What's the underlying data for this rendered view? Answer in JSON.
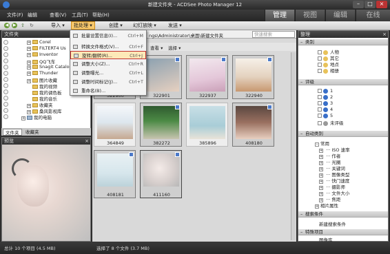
{
  "window": {
    "title": "新建文件夹 - ACDSee Photo Manager 12"
  },
  "menu": {
    "items": [
      "文件(F)",
      "编辑",
      "查看(V)",
      "工具(T)",
      "帮助(H)"
    ]
  },
  "modes": [
    "管理",
    "视图",
    "编辑",
    "在线"
  ],
  "toolbar": {
    "import": "导入",
    "batch": "批处理",
    "create": "创建",
    "slideshow": "幻灯放映",
    "send": "发送"
  },
  "batch_menu": {
    "items": [
      {
        "label": "批量设置信息(I)...",
        "shortcut": "Ctrl+M"
      },
      {
        "label": "转换文件格式(V)...",
        "shortcut": "Ctrl+F"
      },
      {
        "label": "旋转/翻转(R)...",
        "shortcut": "Ctrl+J"
      },
      {
        "label": "调整大小(Z)...",
        "shortcut": "Ctrl+R"
      },
      {
        "label": "调整曝光...",
        "shortcut": "Ctrl+L"
      },
      {
        "label": "调整时间标记(J)...",
        "shortcut": "Ctrl+T"
      },
      {
        "label": "重命名(B)...",
        "shortcut": ""
      }
    ]
  },
  "folders": {
    "header": "文件夹",
    "items": [
      "Corel",
      "FILTERT4 Us",
      "Inventor",
      "QQ飞车",
      "Snagit Catalog",
      "Thunder",
      "图片收藏",
      "我的视频",
      "我的调色板",
      "我的音乐",
      "收藏夹",
      "桑风影视库",
      "我的电脑"
    ],
    "tabs": [
      "文件夹",
      "收藏夹"
    ]
  },
  "preview": {
    "header": "预览"
  },
  "path": {
    "text": "ngs\\Administrator\\桌面\\新建文件夹",
    "search_placeholder": "快速搜索"
  },
  "filter": {
    "view": "查看",
    "select": "选择"
  },
  "thumbs": [
    {
      "caption": "322900"
    },
    {
      "caption": "322901"
    },
    {
      "caption": "322937"
    },
    {
      "caption": "322940"
    },
    {
      "caption": "364849"
    },
    {
      "caption": "382272"
    },
    {
      "caption": "385896"
    },
    {
      "caption": "408180"
    },
    {
      "caption": "408181"
    },
    {
      "caption": "411160"
    }
  ],
  "organize": {
    "header": "整理",
    "categories": {
      "title": "类别",
      "items": [
        "人物",
        "其它",
        "地点",
        "相册"
      ]
    },
    "ratings": {
      "title": "评级",
      "items": [
        "1",
        "2",
        "3",
        "4",
        "5",
        "未评级"
      ]
    },
    "auto": {
      "title": "自动类别",
      "items": [
        "常用",
        "ISO 速率",
        "作者",
        "光圈",
        "关键词",
        "图像类型",
        "快门速度",
        "摄影师",
        "文件大小",
        "焦距",
        "相片属性"
      ]
    },
    "search": {
      "title": "搜索条件",
      "new": "新建搜索条件"
    },
    "special": {
      "title": "特殊项目",
      "first": "图像库"
    }
  },
  "status": {
    "total": "总计 10 个项目 (4.5 MB)",
    "selected": "选择了 8 个文件 (3.7 MB)"
  }
}
